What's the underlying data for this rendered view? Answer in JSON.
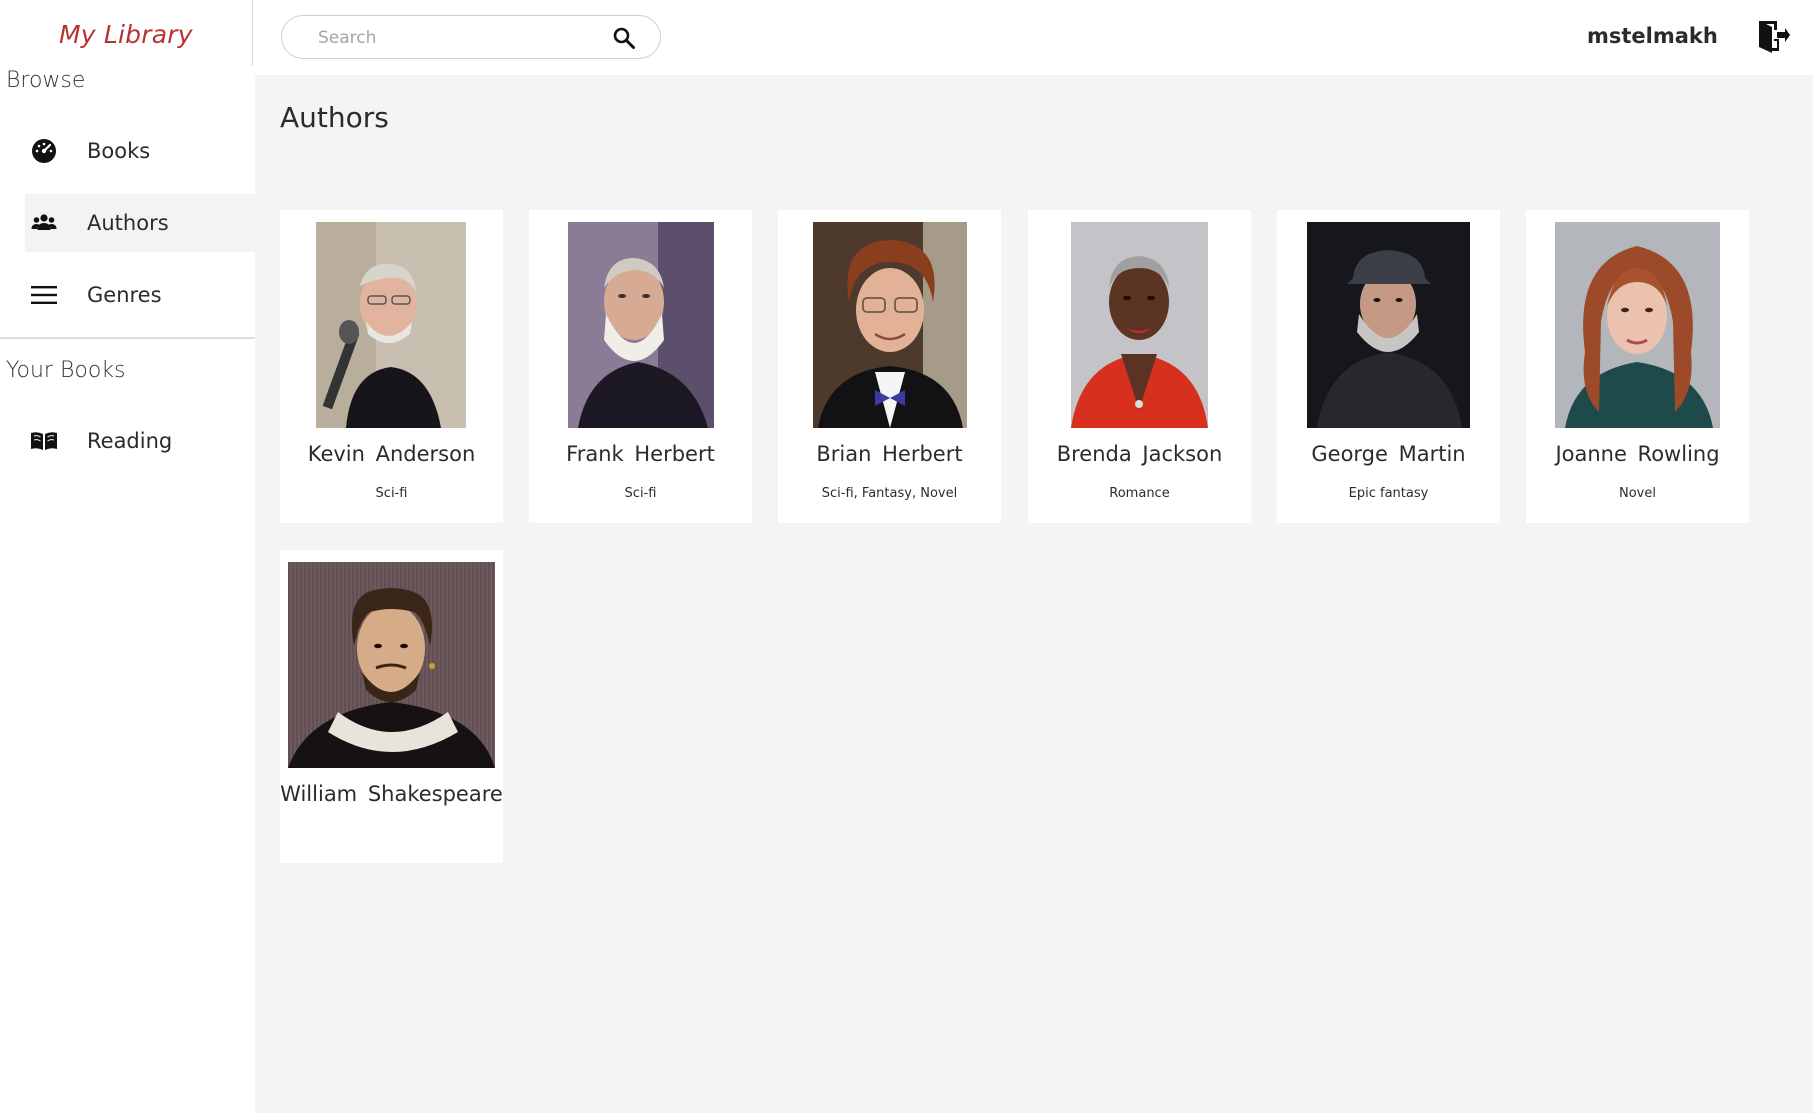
{
  "app": {
    "logo": "My Library"
  },
  "sidebar": {
    "browse_title": "Browse",
    "browse_items": [
      {
        "label": "Books",
        "icon": "gauge-icon",
        "active": false
      },
      {
        "label": "Authors",
        "icon": "users-icon",
        "active": true
      },
      {
        "label": "Genres",
        "icon": "list-icon",
        "active": false
      }
    ],
    "your_books_title": "Your Books",
    "your_books_items": [
      {
        "label": "Reading",
        "icon": "open-book-icon",
        "active": false
      }
    ]
  },
  "header": {
    "search": {
      "placeholder": "Search",
      "value": ""
    },
    "username": "mstelmakh",
    "logout_icon": "logout-door-icon"
  },
  "main": {
    "title": "Authors",
    "authors": [
      {
        "name": "Kevin  Anderson",
        "genres": "Sci-fi"
      },
      {
        "name": "Frank Herbert",
        "genres": "Sci-fi"
      },
      {
        "name": "Brian Herbert",
        "genres": "Sci-fi, Fantasy, Novel"
      },
      {
        "name": "Brenda  Jackson",
        "genres": "Romance"
      },
      {
        "name": "George Martin",
        "genres": "Epic fantasy"
      },
      {
        "name": "Joanne Rowling",
        "genres": "Novel"
      },
      {
        "name": "William  Shakespeare",
        "genres": ""
      }
    ]
  },
  "colors": {
    "logo": "#b8332f",
    "main_background": "#f4f4f4",
    "active_nav": "#f3f3f3"
  }
}
